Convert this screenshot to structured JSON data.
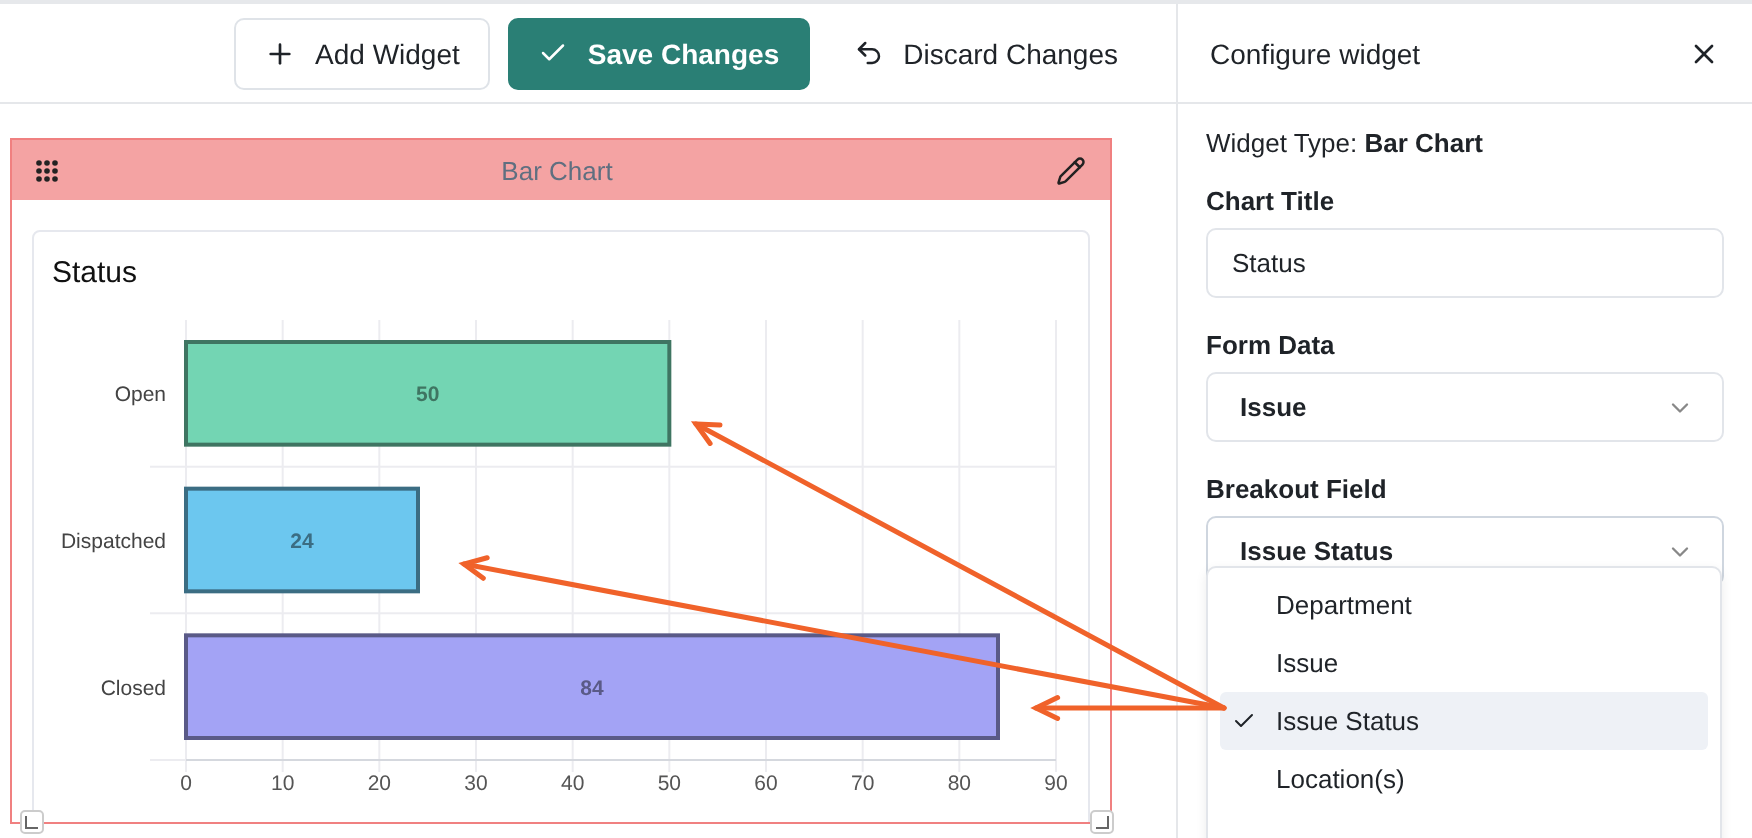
{
  "toolbar": {
    "buttons": [
      {
        "label": "Add Widget",
        "kind": "add"
      },
      {
        "label": "Save Changes",
        "kind": "save"
      },
      {
        "label": "Discard Changes",
        "kind": "discard"
      }
    ]
  },
  "widget": {
    "header": "Bar Chart",
    "card_title": "Status",
    "chart_data": {
      "type": "bar",
      "orientation": "horizontal",
      "categories": [
        "Open",
        "Dispatched",
        "Closed"
      ],
      "values": [
        50,
        24,
        84
      ],
      "colors": [
        "#73d5b3",
        "#6cc7ef",
        "#a3a3f5"
      ],
      "xlim": [
        0,
        90
      ],
      "xticks": [
        0,
        10,
        20,
        30,
        40,
        50,
        60,
        70,
        80,
        90
      ],
      "data_labels": true,
      "grid": true
    }
  },
  "panel": {
    "title": "Configure widget",
    "widget_type": "Widget Type: **Bar Chart**",
    "fields": [
      {
        "label": "Chart Title",
        "kind": "text",
        "value": "Status"
      },
      {
        "label": "Form Data",
        "kind": "select",
        "value": "Issue",
        "expanded": false
      },
      {
        "label": "Breakout Field",
        "kind": "select",
        "value": "Issue Status",
        "expanded": true
      }
    ],
    "options": [
      {
        "label": "Department",
        "selected": false
      },
      {
        "label": "Issue",
        "selected": false
      },
      {
        "label": "Issue Status",
        "selected": true
      },
      {
        "label": "Location(s)",
        "selected": false
      }
    ]
  }
}
